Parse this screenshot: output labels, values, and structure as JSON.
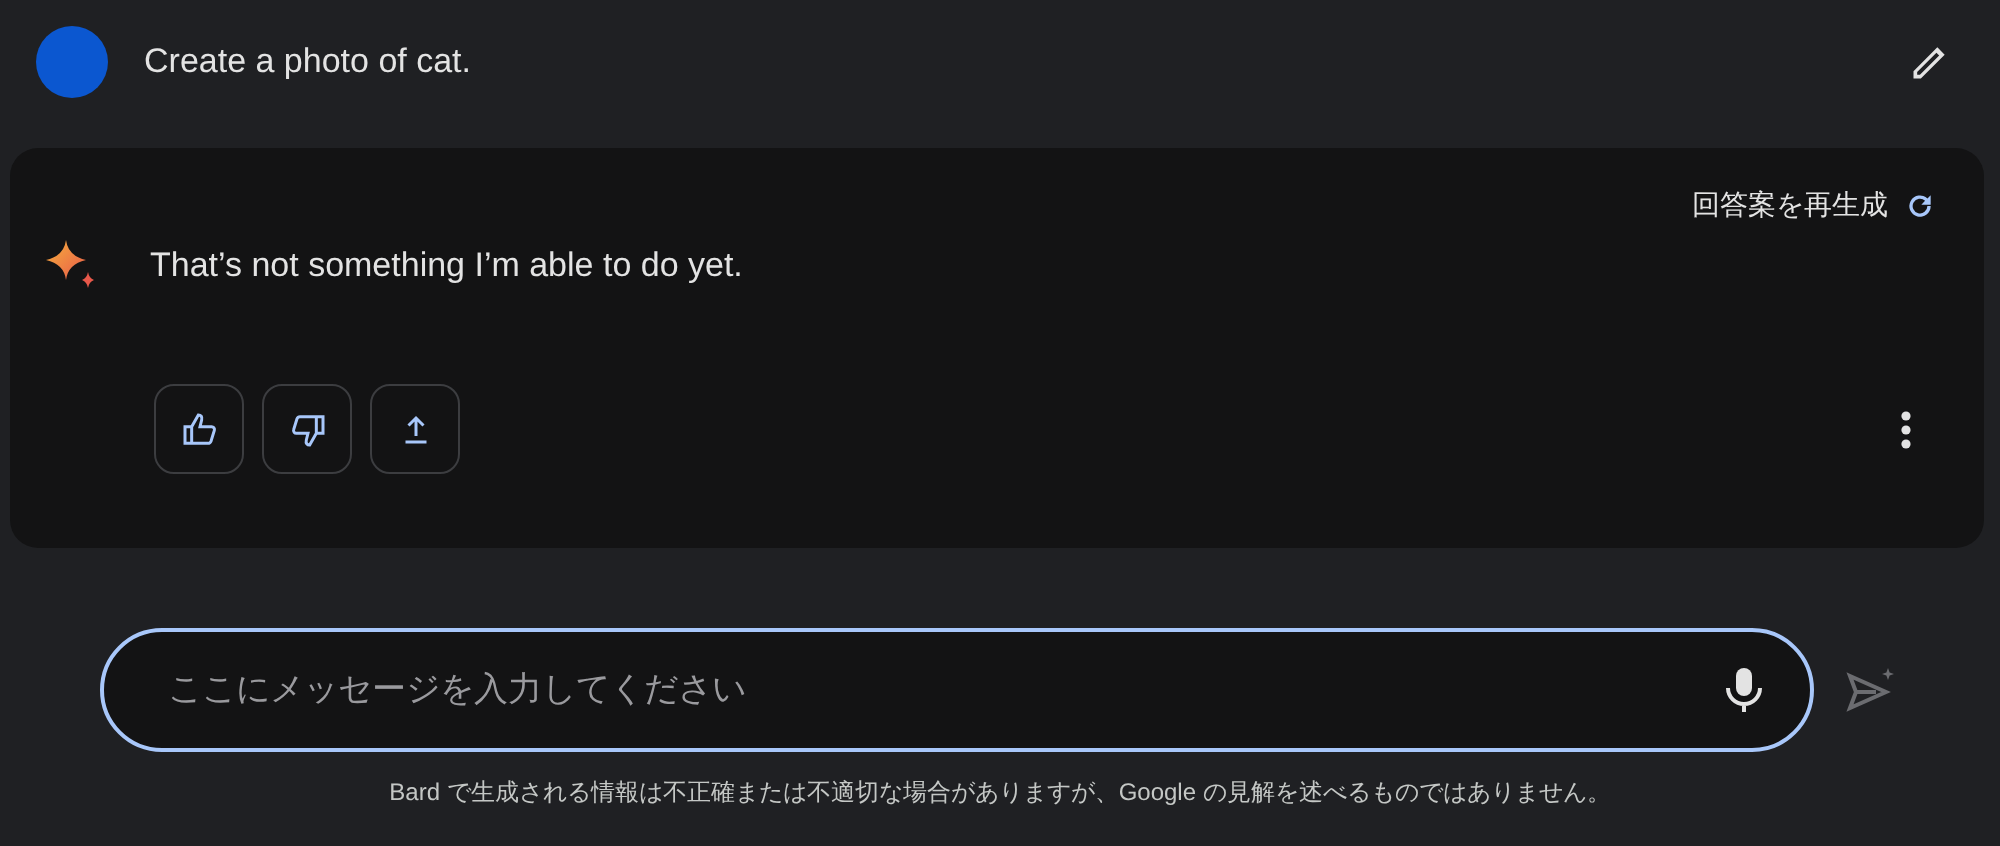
{
  "user_message": {
    "text": "Create a photo of cat."
  },
  "response": {
    "regenerate_label": "回答案を再生成",
    "text": "That’s not something I’m able to do yet."
  },
  "composer": {
    "placeholder": "ここにメッセージを入力してください",
    "send_disabled": true
  },
  "disclaimer": "Bard で生成される情報は不正確または不適切な場合がありますが、Google の見解を述べるものではありません。"
}
